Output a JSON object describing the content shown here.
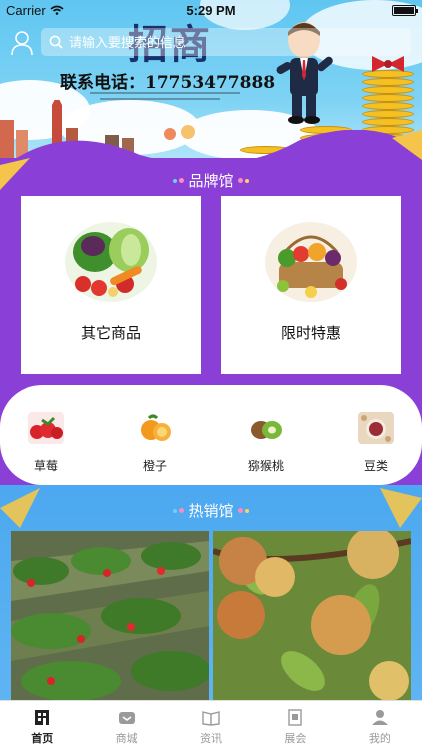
{
  "status_bar": {
    "carrier": "Carrier",
    "time": "5:29 PM"
  },
  "search": {
    "placeholder": "请输入要搜索的信息"
  },
  "banner": {
    "title": "招商",
    "phone": "联系电话：17753477888"
  },
  "brand_section": {
    "title": "品牌馆",
    "cards": [
      {
        "label": "其它商品"
      },
      {
        "label": "限时特惠"
      }
    ]
  },
  "categories": [
    {
      "label": "草莓",
      "icon": "strawberry-icon"
    },
    {
      "label": "橙子",
      "icon": "orange-icon"
    },
    {
      "label": "猕猴桃",
      "icon": "kiwi-icon"
    },
    {
      "label": "豆类",
      "icon": "beans-icon"
    }
  ],
  "hot_section": {
    "title": "热销馆"
  },
  "tabbar": [
    {
      "label": "首页",
      "icon": "home-icon",
      "active": true
    },
    {
      "label": "商城",
      "icon": "store-icon",
      "active": false
    },
    {
      "label": "资讯",
      "icon": "news-icon",
      "active": false
    },
    {
      "label": "展会",
      "icon": "exhibition-icon",
      "active": false
    },
    {
      "label": "我的",
      "icon": "profile-icon",
      "active": false
    }
  ],
  "colors": {
    "purple": "#8a3fd6",
    "sky": "#5fc6f1",
    "hot_blue": "#4ca8f0"
  }
}
